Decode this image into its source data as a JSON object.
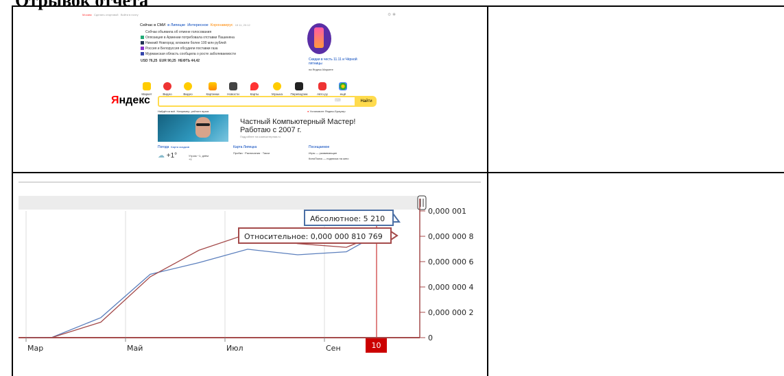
{
  "document": {
    "title": "Отрывок отчета"
  },
  "yandex": {
    "top_links": [
      "Москва",
      "Сделать стартовой",
      "Войти в почту"
    ],
    "news_tabs": [
      "Сейчас в СМИ",
      "в Липецке",
      "Интересное"
    ],
    "news_extra": "Коронавирус",
    "news_time": "15 11, 20:12",
    "news": [
      "Собчак объявила об отмене голосования",
      "Оппозиция в Армении потребовала отставки Пашиняна",
      "Нижний Новгород: вложили более 100 млн рублей",
      "Россия и Белоруссия обсудили поставки газа",
      "Мурманская область сообщила о росте заболеваемости"
    ],
    "quotes": {
      "usd": "USD 76,25",
      "eur": "EUR 90,25",
      "oil": "НЕФТЬ 44,42"
    },
    "promo": {
      "title": "Скидки в честь 11.11 и Чёрной пятницы",
      "sub": "на Яндекс.Маркете"
    },
    "services": [
      "Маркет",
      "Видео",
      "Видео",
      "Картинки",
      "Новости",
      "Карты",
      "Музыка",
      "Переводчик",
      "Авто.ру",
      "ещё"
    ],
    "logo_first": "Я",
    "logo_rest": "ндекс",
    "search_button": "Найти",
    "search_hint": "Найдётся всё. Например, рейтинг вузов",
    "browser_hint": "Установите Яндекс.Браузер",
    "banner": {
      "headline_1": "Частный Компьютерный Мастер!",
      "headline_2": "Работаю с 2007 г.",
      "sub": "Подробнее на компьютерная.ru"
    },
    "weather": {
      "title": "Погода",
      "link": "Карта осадков",
      "temp": "+1°",
      "detail": "Утром −1, днём +1"
    },
    "map": {
      "title": "Карта Липецка",
      "items": "Пробки · Расписания · Такси"
    },
    "visited": {
      "title": "Посещаемое",
      "items": "Игры — развивающие",
      "kino": "КиноПоиск — подписка на кино"
    }
  },
  "chart_data": {
    "type": "line",
    "x_labels": [
      "Мар",
      "Май",
      "Июл",
      "Сен"
    ],
    "series": [
      {
        "color": "#5b7fbd",
        "values": [
          0.0,
          2.7e-09,
          1.58e-07,
          5e-07,
          5.92e-07,
          6.98e-07,
          6.54e-07,
          6.78e-07,
          8.11e-07
        ]
      },
      {
        "color": "#a44a4a",
        "values": [
          0.0,
          1.5e-09,
          1.22e-07,
          4.8e-07,
          6.9e-07,
          8.19e-07,
          7.42e-07,
          7.13e-07,
          8.11e-07
        ]
      }
    ],
    "y_ticks": [
      "0,000 001",
      "0,000 000 8",
      "0,000 000 6",
      "0,000 000 4",
      "0,000 000 2",
      "0"
    ],
    "ylim": [
      0,
      1e-06
    ],
    "tooltip_abs": "Абсолютное: 5 210",
    "tooltip_rel": "Относительное: 0,000 000 810 769",
    "cursor_label": "10",
    "handle_icon": "pause-icon",
    "colors": {
      "absolute": "#5b7fbd",
      "relative": "#a44a4a",
      "cursor": "#cc0000"
    }
  }
}
